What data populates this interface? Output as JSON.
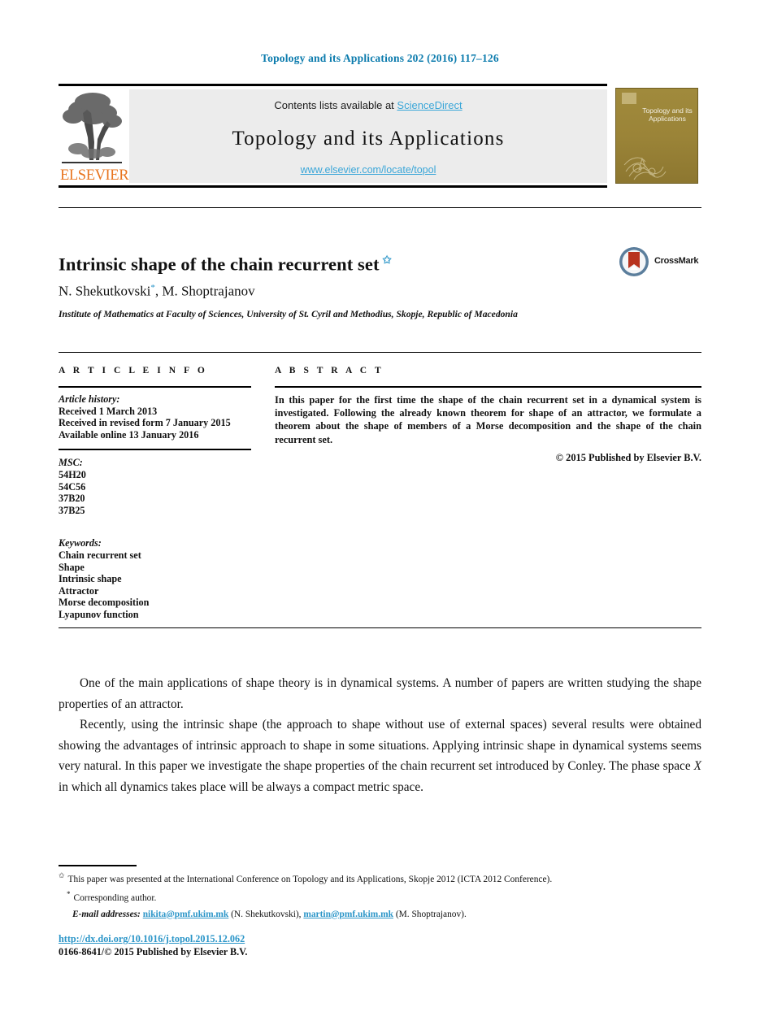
{
  "running_head": "Topology and its Applications 202 (2016) 117–126",
  "masthead": {
    "contents_prefix": "Contents lists available at ",
    "sciencedirect_label": "ScienceDirect",
    "journal_name": "Topology and its Applications",
    "journal_url": "www.elsevier.com/locate/topol",
    "publisher_wordmark": "ELSEVIER",
    "cover_title": "Topology and its Applications"
  },
  "article": {
    "title": "Intrinsic shape of the chain recurrent set",
    "title_footnote_marker": "✩",
    "authors": "N. Shekutkovski",
    "authors_marker": "*",
    "authors_rest": ", M. Shoptrajanov",
    "affiliation": "Institute of Mathematics at Faculty of Sciences, University of St. Cyril and Methodius, Skopje, Republic of Macedonia",
    "crossmark_label": "CrossMark"
  },
  "info": {
    "heading": "A R T I C L E   I N F O",
    "history_label": "Article history:",
    "history_lines": "Received 1 March 2013\nReceived in revised form 7 January 2015\nAvailable online 13 January 2016",
    "msc_label": "MSC:",
    "msc_codes": "54H20\n54C56\n37B20\n37B25",
    "keywords_label": "Keywords:",
    "keywords": "Chain recurrent set\nShape\nIntrinsic shape\nAttractor\nMorse decomposition\nLyapunov function"
  },
  "abstract": {
    "heading": "A B S T R A C T",
    "text": "In this paper for the first time the shape of the chain recurrent set in a dynamical system is investigated. Following the already known theorem for shape of an attractor, we formulate a theorem about the shape of members of a Morse decomposition and the shape of the chain recurrent set.",
    "copyright": "© 2015 Published by Elsevier B.V."
  },
  "body": {
    "paragraph_1": "One of the main applications of shape theory is in dynamical systems. A number of papers are written studying the shape properties of an attractor.",
    "paragraph_2_part1": "Recently, using the intrinsic shape (the approach to shape without use of external spaces) several results were obtained showing the advantages of intrinsic approach to shape in some situations. Applying intrinsic shape in dynamical systems seems very natural. In this paper we investigate the shape properties of the chain recurrent set introduced by Conley. The phase space ",
    "paragraph_2_var": "X",
    "paragraph_2_part2": " in which all dynamics takes place will be always a compact metric space."
  },
  "footnotes": {
    "conference_note": "This paper was presented at the International Conference on Topology and its Applications, Skopje 2012 (ICTA 2012 Conference).",
    "corresponding_author": "Corresponding author.",
    "emails_label": "E-mail addresses:",
    "email_1": "nikita@pmf.ukim.mk",
    "email_1_owner": "(N. Shekutkovski),",
    "email_2": "martin@pmf.ukim.mk",
    "email_2_owner": "(M. Shoptrajanov).",
    "doi": "http://dx.doi.org/10.1016/j.topol.2015.12.062",
    "issn_line": "0166-8641/© 2015 Published by Elsevier B.V."
  },
  "colors": {
    "link_blue": "#2a95c8",
    "sciencedirect_blue": "#3aa6d8",
    "running_head_blue": "#0b7bad",
    "elsevier_orange": "#e8741e",
    "cover_gold": "#9b8438",
    "banner_grey": "#ececec"
  }
}
